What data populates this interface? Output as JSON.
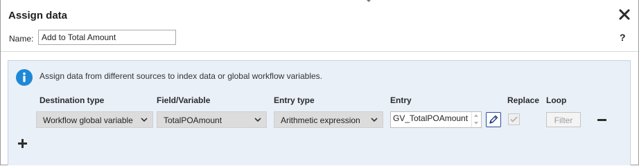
{
  "dialog": {
    "title": "Assign data",
    "close_icon": "close-icon",
    "help_label": "?"
  },
  "name_field": {
    "label": "Name:",
    "value": "Add to Total Amount"
  },
  "panel": {
    "info_icon": "info-icon",
    "info_text": "Assign data from different sources to index data or global workflow variables.",
    "columns": {
      "destination_type": "Destination type",
      "field_variable": "Field/Variable",
      "entry_type": "Entry type",
      "entry": "Entry",
      "replace": "Replace",
      "loop": "Loop"
    },
    "row": {
      "destination_type": "Workflow global variable",
      "field_variable": "TotalPOAmount",
      "entry_type": "Arithmetic expression",
      "entry": "GV_TotalPOAmount",
      "replace_checked": true,
      "replace_disabled": true,
      "filter_label": "Filter",
      "remove_icon": "minus-icon"
    },
    "add_icon": "plus-icon"
  },
  "colors": {
    "panel_bg": "#e9f0f8",
    "info_blue": "#1e88d6",
    "select_bg": "#dcdcdc",
    "pencil_border": "#2a4d9b"
  }
}
